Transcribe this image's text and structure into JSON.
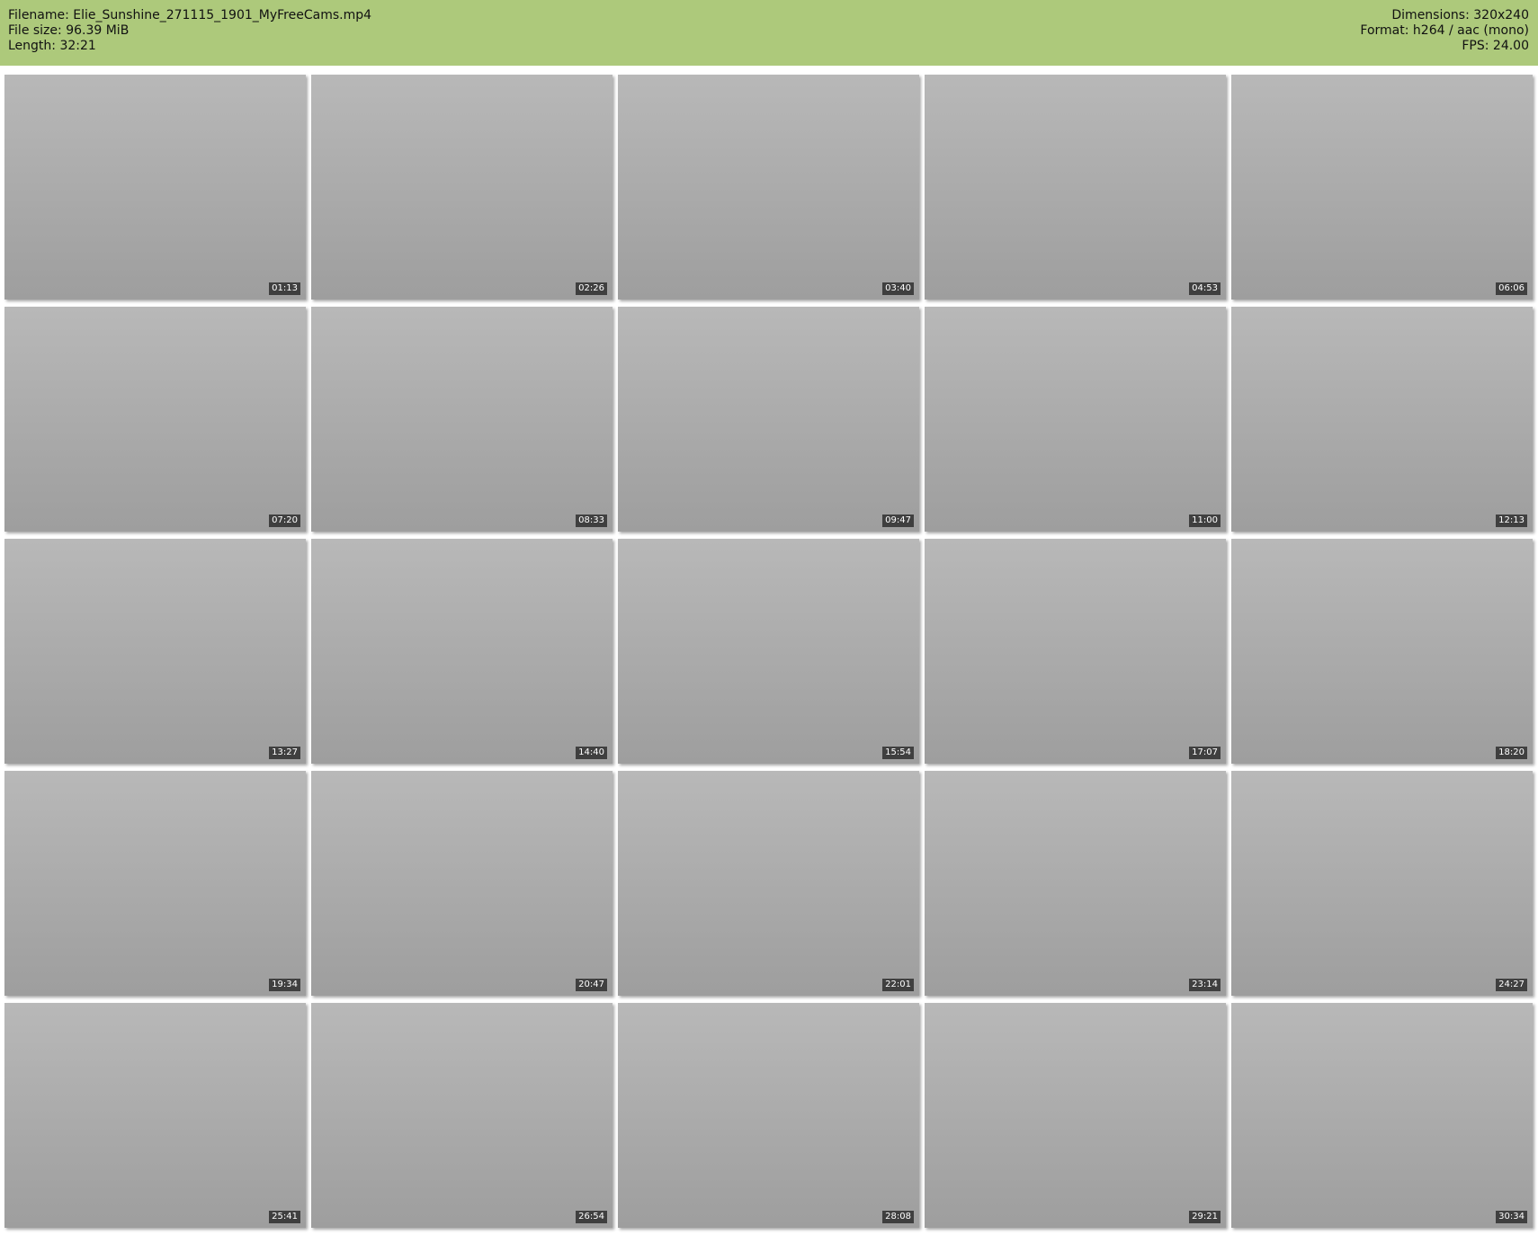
{
  "header": {
    "filename": "Filename: Elie_Sunshine_271115_1901_MyFreeCams.mp4",
    "file_size": "File size: 96.39 MiB",
    "length": "Length: 32:21",
    "dimensions": "Dimensions: 320x240",
    "format": "Format: h264 / aac (mono)",
    "fps": "FPS: 24.00"
  },
  "frames": [
    {
      "time": "01:13"
    },
    {
      "time": "02:26"
    },
    {
      "time": "03:40"
    },
    {
      "time": "04:53"
    },
    {
      "time": "06:06"
    },
    {
      "time": "07:20"
    },
    {
      "time": "08:33"
    },
    {
      "time": "09:47"
    },
    {
      "time": "11:00"
    },
    {
      "time": "12:13"
    },
    {
      "time": "13:27"
    },
    {
      "time": "14:40"
    },
    {
      "time": "15:54"
    },
    {
      "time": "17:07"
    },
    {
      "time": "18:20"
    },
    {
      "time": "19:34"
    },
    {
      "time": "20:47"
    },
    {
      "time": "22:01"
    },
    {
      "time": "23:14"
    },
    {
      "time": "24:27"
    },
    {
      "time": "25:41"
    },
    {
      "time": "26:54"
    },
    {
      "time": "28:08"
    },
    {
      "time": "29:21"
    },
    {
      "time": "30:34"
    }
  ]
}
